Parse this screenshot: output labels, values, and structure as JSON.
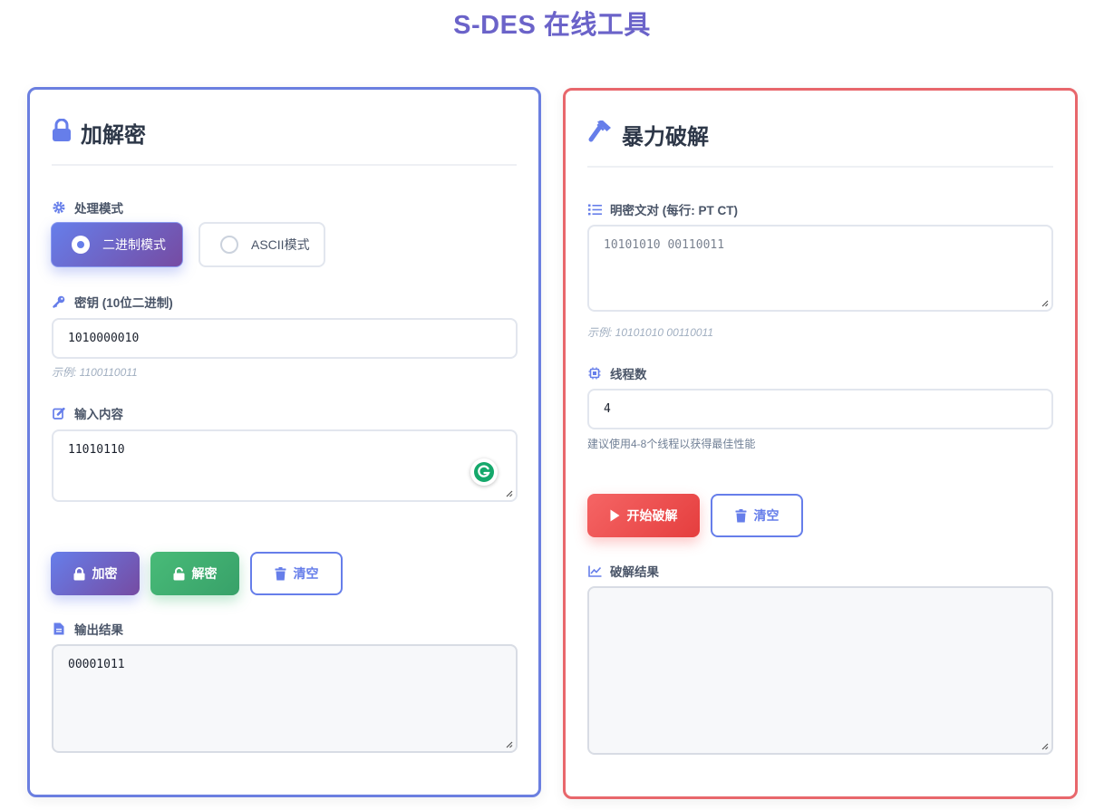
{
  "page": {
    "title": "S-DES 在线工具"
  },
  "crypto_panel": {
    "title": "加解密",
    "mode": {
      "label": "处理模式",
      "options": [
        {
          "label": "二进制模式",
          "selected": true
        },
        {
          "label": "ASCII模式",
          "selected": false
        }
      ]
    },
    "key": {
      "label": "密钥 (10位二进制)",
      "value": "1010000010",
      "hint": "示例: 1100110011"
    },
    "input": {
      "label": "输入内容",
      "value": "11010110"
    },
    "buttons": {
      "encrypt": "加密",
      "decrypt": "解密",
      "clear": "清空"
    },
    "output": {
      "label": "输出结果",
      "value": "00001011"
    }
  },
  "brute_panel": {
    "title": "暴力破解",
    "pairs": {
      "label": "明密文对 (每行: PT CT)",
      "placeholder": "10101010 00110011",
      "hint": "示例: 10101010 00110011"
    },
    "threads": {
      "label": "线程数",
      "value": "4",
      "hint": "建议使用4-8个线程以获得最佳性能"
    },
    "buttons": {
      "start": "开始破解",
      "clear": "清空"
    },
    "result": {
      "label": "破解结果",
      "value": ""
    }
  },
  "colors": {
    "title": "#6b63c9",
    "accent": "#667eea",
    "left_border": "#6b7fe0",
    "right_border": "#e8676c",
    "success": "#48bb78",
    "danger": "#f56565"
  }
}
